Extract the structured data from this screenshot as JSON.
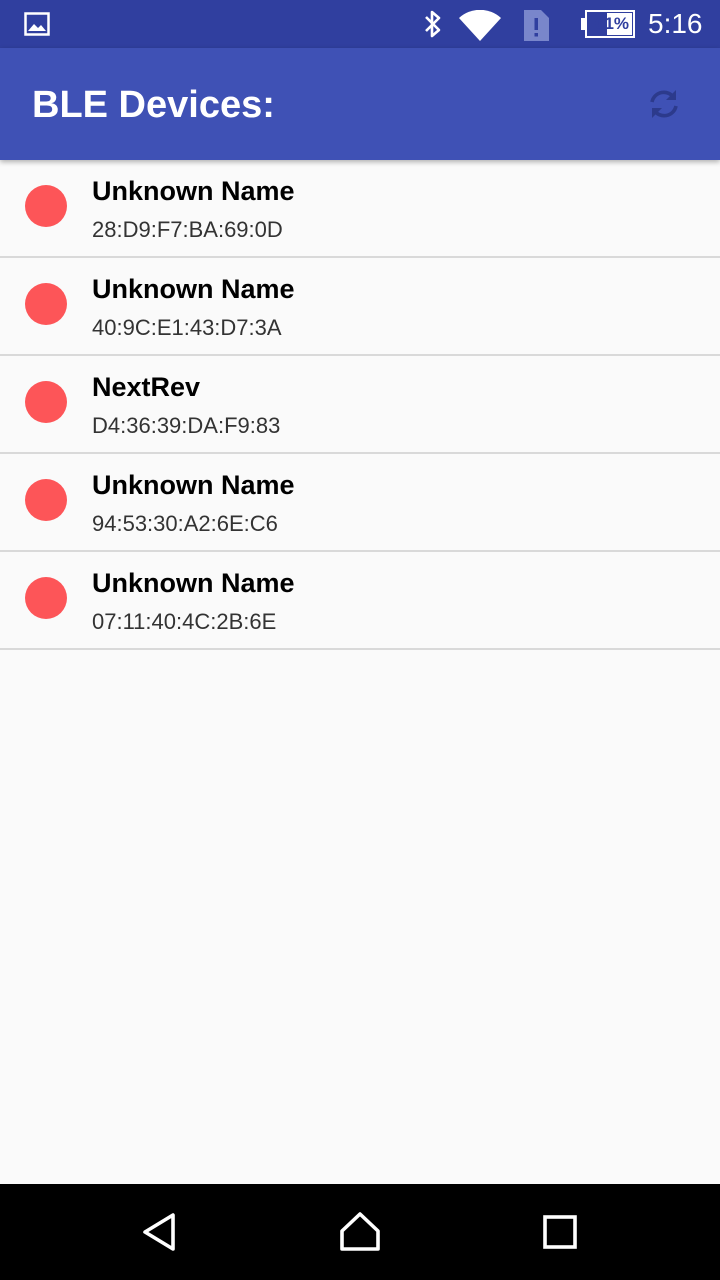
{
  "status_bar": {
    "battery": "61%",
    "time": "5:16",
    "icons": [
      "gallery-icon",
      "bluetooth-icon",
      "wifi-icon",
      "sim-alert-icon",
      "battery-icon"
    ]
  },
  "app_bar": {
    "title": "BLE Devices:",
    "refresh_icon": "refresh-icon"
  },
  "devices": [
    {
      "name": "Unknown Name",
      "address": "28:D9:F7:BA:69:0D"
    },
    {
      "name": "Unknown Name",
      "address": "40:9C:E1:43:D7:3A"
    },
    {
      "name": "NextRev",
      "address": "D4:36:39:DA:F9:83"
    },
    {
      "name": "Unknown Name",
      "address": "94:53:30:A2:6E:C6"
    },
    {
      "name": "Unknown Name",
      "address": "07:11:40:4C:2B:6E"
    }
  ],
  "colors": {
    "status_bar": "#303f9f",
    "app_bar": "#3f51b5",
    "status_dot": "#fd5558",
    "background": "#fafafa"
  },
  "nav_bar": {
    "icons": [
      "back-icon",
      "home-icon",
      "recents-icon"
    ]
  }
}
